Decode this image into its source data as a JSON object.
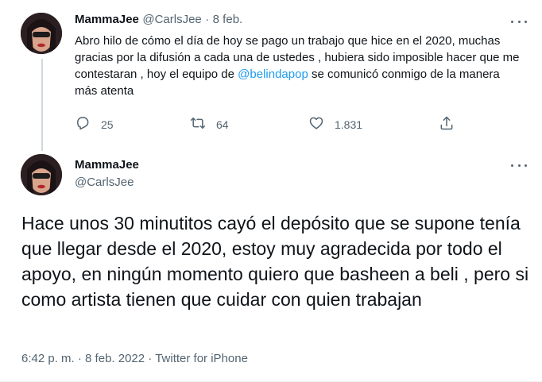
{
  "parent_tweet": {
    "display_name": "MammaJee",
    "handle": "@CarlsJee",
    "separator": "·",
    "date": "8 feb.",
    "text_before_mention": "Abro hilo de cómo el día de hoy se pago un trabajo que hice en el 2020, muchas gracias por la difusión a cada una de ustedes , hubiera sido imposible hacer que me contestaran , hoy el equipo de ",
    "mention": "@belindapop",
    "text_after_mention": " se comunicó conmigo de la manera más atenta",
    "replies": "25",
    "retweets": "64",
    "likes": "1.831",
    "icons": {
      "more": "more-dots-icon",
      "reply": "reply-icon",
      "retweet": "retweet-icon",
      "like": "heart-icon",
      "share": "share-icon"
    }
  },
  "main_tweet": {
    "display_name": "MammaJee",
    "handle": "@CarlsJee",
    "text": "Hace unos 30 minutitos cayó el depósito que se supone tenía que llegar desde el 2020, estoy muy agradecida por todo el apoyo, en ningún momento quiero que basheen a beli , pero si como artista tienen que cuidar con quien trabajan",
    "time": "6:42 p. m.",
    "separator": "·",
    "date": "8 feb. 2022",
    "source": "Twitter for iPhone"
  },
  "colors": {
    "text": "#0f1419",
    "muted": "#536471",
    "link": "#1d9bf0",
    "line": "#cfd9de"
  }
}
